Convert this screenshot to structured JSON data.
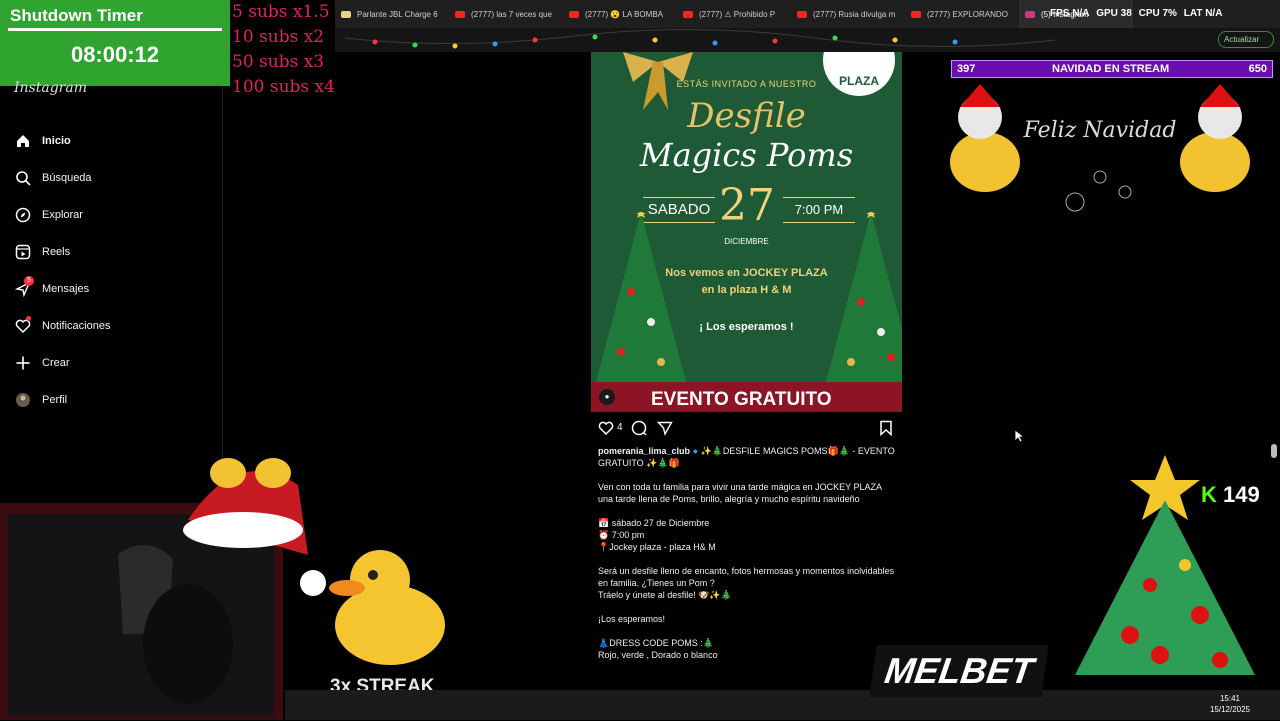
{
  "timer": {
    "title": "Shutdown Timer",
    "time": "08:00:12"
  },
  "subs_multipliers": [
    "5 subs x1.5",
    "10 subs x2",
    "50 subs x3",
    "100 subs x4"
  ],
  "browser": {
    "tabs": [
      {
        "label": "Parlante JBL Charge 6",
        "color": "#e8d38a"
      },
      {
        "label": "(2777) las 7 veces que",
        "color": "#ff2222"
      },
      {
        "label": "(2777) 😮 LA BOMBA",
        "color": "#ff2222"
      },
      {
        "label": "(2777) ⚠ Prohibido P",
        "color": "#ff2222"
      },
      {
        "label": "(2777) Rusia divulga m",
        "color": "#ff2222"
      },
      {
        "label": "(2777) EXPLORANDO",
        "color": "#ff2222"
      },
      {
        "label": "(5) Instagram",
        "color": "#d63384"
      }
    ],
    "update_label": "Actualizar"
  },
  "overlay_status": {
    "fps": "FPS N/A",
    "gpu": "GPU 38",
    "cpu": "CPU 7%",
    "lat": "LAT N/A"
  },
  "instagram": {
    "logo": "Instagram",
    "nav": [
      {
        "label": "Inicio",
        "icon": "home-icon",
        "bold": true
      },
      {
        "label": "Búsqueda",
        "icon": "search-icon"
      },
      {
        "label": "Explorar",
        "icon": "compass-icon"
      },
      {
        "label": "Reels",
        "icon": "reels-icon"
      },
      {
        "label": "Mensajes",
        "icon": "messages-icon",
        "badge": "5"
      },
      {
        "label": "Notificaciones",
        "icon": "heart-icon"
      },
      {
        "label": "Crear",
        "icon": "plus-icon"
      },
      {
        "label": "Perfil",
        "icon": "avatar"
      }
    ]
  },
  "poster": {
    "logo": "PLAZA",
    "invite": "ESTÁS INVITADO A NUESTRO",
    "desfile": "Desfile",
    "magics": "Magics Poms",
    "day": "SABADO",
    "date": "27",
    "time": "7:00 PM",
    "month": "DICIEMBRE",
    "location_line1": "Nos vemos en JOCKEY PLAZA",
    "location_line2": "en la plaza H & M",
    "wait": "¡ Los esperamos !",
    "banner": "EVENTO GRATUITO"
  },
  "post": {
    "likes": "4",
    "username": "pomerania_lima_club",
    "caption_title": "✨🎄DESFILE MAGICS POMS🎁🎄 - EVENTO GRATUITO ✨🎄🎁",
    "paragraph1": "Ven con toda tu familia para vivir una tarde mágica en JOCKEY PLAZA una tarde llena de Poms, brillo, alegría y mucho espíritu navideño",
    "date_line": "📅 sábado 27 de Diciembre",
    "time_line": "⏰ 7:00 pm",
    "place_line": "📍Jockey plaza - plaza H& M",
    "paragraph2_l1": "Será un desfile lleno de encanto, fotos hermosas y momentos inolvidables en familia. ¿Tienes un Pom ?",
    "paragraph2_l2": "Tráelo y únete al desfile! 🐶✨🎄",
    "closing": "¡Los esperamos!",
    "dress_title": "👗DRESS CODE POMS :🎄",
    "dress_colors": "Rojo, verde , Dorado o blanco"
  },
  "navidad_bar": {
    "left": "397",
    "title": "NAVIDAD EN STREAM",
    "right": "650"
  },
  "kick_count": "149",
  "streak": "3x STREAK",
  "sponsor": "MELBET",
  "clock": {
    "time": "15:41",
    "date": "15/12/2025"
  }
}
